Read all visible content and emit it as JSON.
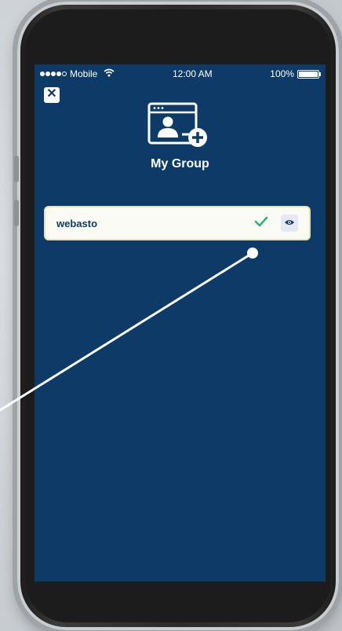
{
  "status_bar": {
    "carrier": "Mobile",
    "time": "12:00 AM",
    "battery": "100%",
    "signal_bars": 4,
    "signal_max": 5,
    "battery_level": 1.0
  },
  "header": {
    "close_icon": "close-icon",
    "group_icon": "add-group-icon",
    "title": "My Group"
  },
  "groups": [
    {
      "name": "webasto",
      "actions": [
        "check-icon",
        "eye-icon"
      ]
    }
  ],
  "colors": {
    "screen_bg": "#0d3a67",
    "card_bg": "#fbfbf6",
    "check": "#2bb07f",
    "eye_bg": "#e4e9f2",
    "eye": "#0d3a67"
  }
}
